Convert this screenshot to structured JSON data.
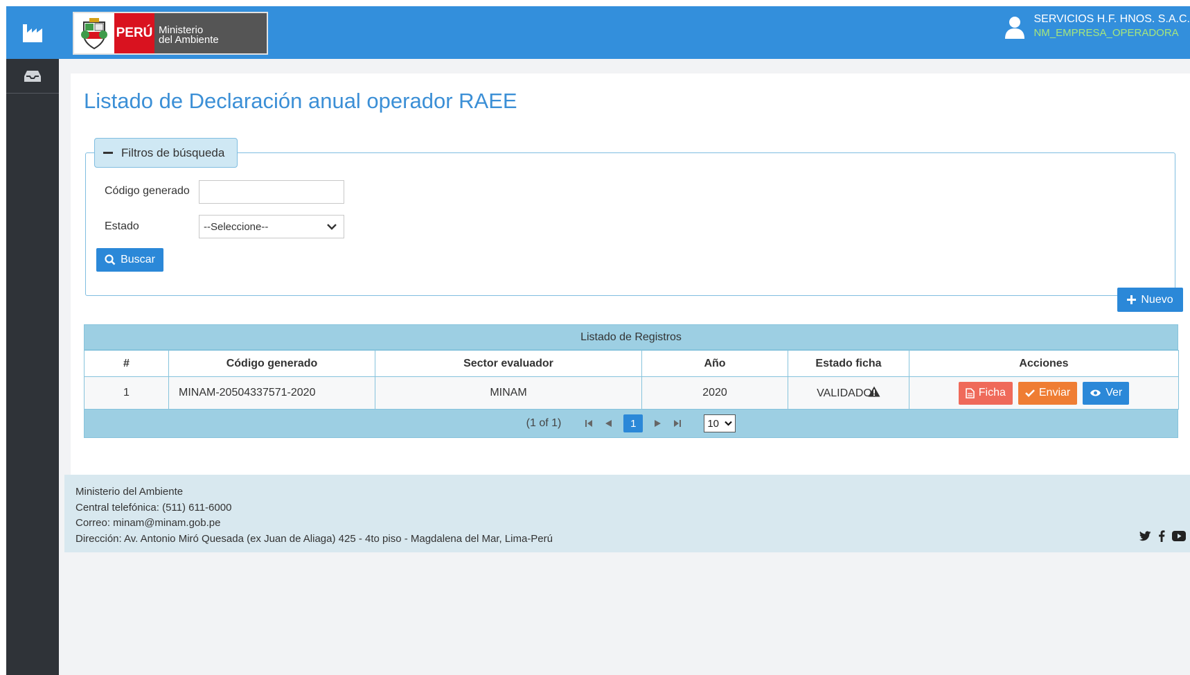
{
  "header": {
    "logo_peru": "PERÚ",
    "logo_ministerio_line1": "Ministerio",
    "logo_ministerio_line2": "del Ambiente",
    "user_company": "SERVICIOS H.F. HNOS. S.A.C.",
    "user_role": "NM_EMPRESA_OPERADORA"
  },
  "sidebar": {
    "items": [
      {
        "icon": "factory-icon"
      },
      {
        "icon": "inbox-icon"
      }
    ]
  },
  "page": {
    "title": "Listado de Declaración anual operador RAEE"
  },
  "filters": {
    "legend": "Filtros de búsqueda",
    "codigo_label": "Código generado",
    "codigo_value": "",
    "estado_label": "Estado",
    "estado_selected": "--Seleccione--",
    "search_button": "Buscar"
  },
  "toolbar": {
    "new_button": "Nuevo"
  },
  "table": {
    "caption": "Listado de Registros",
    "columns": [
      "#",
      "Código generado",
      "Sector evaluador",
      "Año",
      "Estado ficha",
      "Acciones"
    ],
    "rows": [
      {
        "num": "1",
        "codigo": "MINAM-20504337571-2020",
        "sector": "MINAM",
        "anio": "2020",
        "estado": "VALIDADO",
        "actions": [
          "Ficha",
          "Enviar",
          "Ver"
        ]
      }
    ],
    "pager": {
      "summary": "(1 of 1)",
      "current_page": "1",
      "rows_per_page": "10"
    }
  },
  "footer": {
    "line1": "Ministerio del Ambiente",
    "line2": "Central telefónica: (511) 611-6000",
    "line3": "Correo: minam@minam.gob.pe",
    "line4": "Dirección: Av. Antonio Miró Quesada (ex Juan de Aliaga) 425 - 4to piso - Magdalena del Mar, Lima-Perú"
  },
  "colors": {
    "primary": "#338fdc",
    "sidebar": "#2f3338",
    "table_header": "#9dcfe3",
    "danger": "#ef6a5a",
    "warning": "#ef7d33",
    "role_text": "#a6e67c"
  }
}
